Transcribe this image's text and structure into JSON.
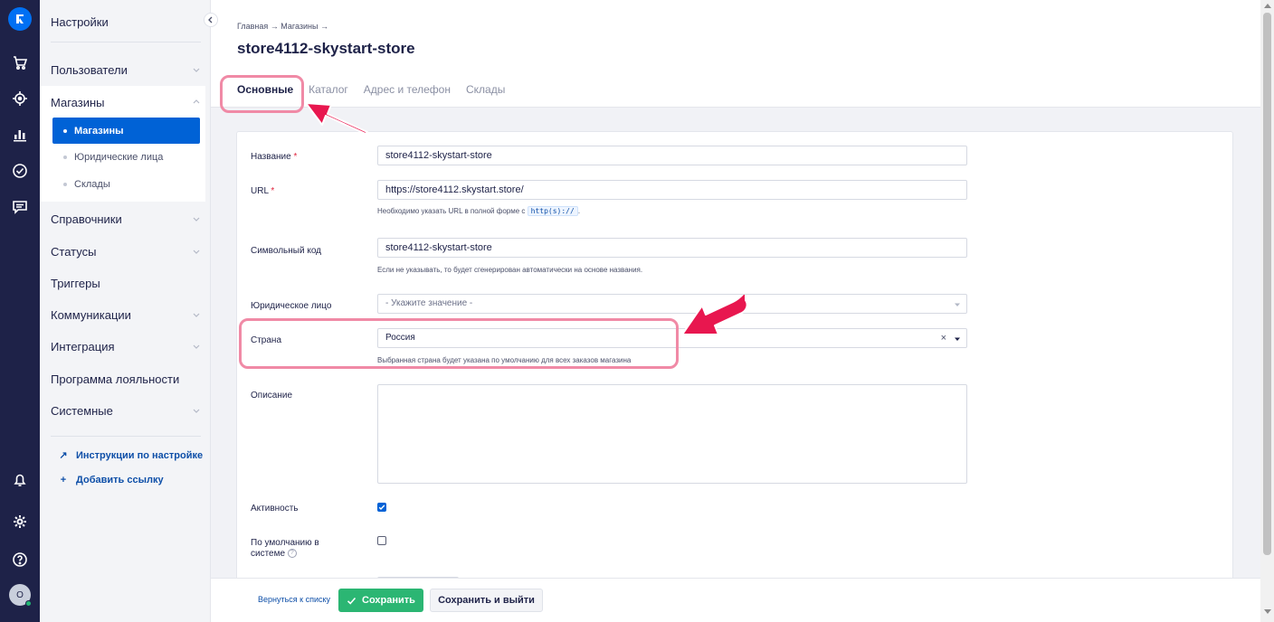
{
  "sidebar": {
    "title": "Настройки",
    "items": [
      {
        "label": "Пользователи",
        "expandable": true
      },
      {
        "label": "Справочники",
        "expandable": true
      },
      {
        "label": "Статусы",
        "expandable": true
      },
      {
        "label": "Триггеры",
        "expandable": false
      },
      {
        "label": "Коммуникации",
        "expandable": true
      },
      {
        "label": "Интеграция",
        "expandable": true
      },
      {
        "label": "Программа лояльности",
        "expandable": false
      },
      {
        "label": "Системные",
        "expandable": true
      }
    ],
    "stores_group": {
      "label": "Магазины",
      "subitems": [
        "Магазины",
        "Юридические лица",
        "Склады"
      ],
      "active": "Магазины"
    },
    "links": [
      {
        "symbol": "↗",
        "label": "Инструкции по настройке"
      },
      {
        "symbol": "+",
        "label": "Добавить ссылку"
      }
    ],
    "avatar_letter": "О"
  },
  "breadcrumb": "Главная → Магазины →",
  "page_title": "store4112-skystart-store",
  "tabs": [
    "Основные",
    "Каталог",
    "Адрес и телефон",
    "Склады"
  ],
  "active_tab": "Основные",
  "form": {
    "name_label": "Название",
    "name_value": "store4112-skystart-store",
    "required_mark": "*",
    "url_label": "URL",
    "url_value": "https://store4112.skystart.store/",
    "url_hint_prefix": "Необходимо указать URL в полной форме с",
    "url_hint_code": "http(s)://",
    "url_hint_suffix": ".",
    "code_label": "Символьный код",
    "code_value": "store4112-skystart-store",
    "code_hint": "Если не указывать, то будет сгенерирован автоматически на основе названия.",
    "legal_label": "Юридическое лицо",
    "legal_placeholder": "- Укажите значение -",
    "country_label": "Страна",
    "country_value": "Россия",
    "country_clear": "×",
    "country_hint": "Выбранная страна будет указана по умолчанию для всех заказов магазина",
    "description_label": "Описание",
    "active_label": "Активность",
    "active_checked": true,
    "default_label": "По умолчанию в системе",
    "default_help": "?",
    "default_checked": false
  },
  "footer": {
    "back_link": "Вернуться к списку",
    "save_button": "Сохранить",
    "save_exit_button": "Сохранить и выйти"
  },
  "colors": {
    "rail": "#1e2248",
    "accent": "#0062d6",
    "save_green": "#2bb673",
    "annotation": "#f08aa6",
    "arrow": "#e8174f"
  }
}
